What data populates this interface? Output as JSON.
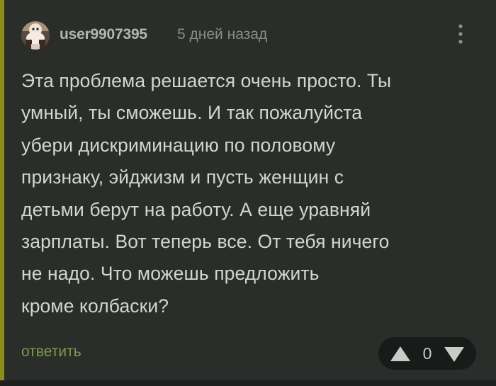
{
  "comment": {
    "author": "user9907395",
    "timestamp": "5 дней назад",
    "text_lines": [
      "Эта проблема решается очень просто. Ты",
      "умный, ты сможешь. И так пожалуйста",
      "убери дискриминацию по половому",
      "признаку, эйджизм и пусть женщин с",
      "детьми берут на работу. А еще уравняй",
      "зарплаты. Вот теперь все. От тебя ничего",
      "не надо. Что можешь предложить",
      "кроме колбаски?"
    ],
    "reply_label": "ответить",
    "rating": "0"
  },
  "icons": {
    "avatar": "avatar-image",
    "menu": "more-vertical-icon",
    "upvote": "upvote-triangle-icon",
    "downvote": "downvote-triangle-icon"
  },
  "colors": {
    "background": "#2b2d2a",
    "accent_bar": "#8a8c1c",
    "text": "#d3d5cf",
    "username": "#b4b7b0",
    "timestamp": "#8a8d86",
    "reply_link": "#7e9a4a",
    "vote_box": "#191b1a"
  }
}
